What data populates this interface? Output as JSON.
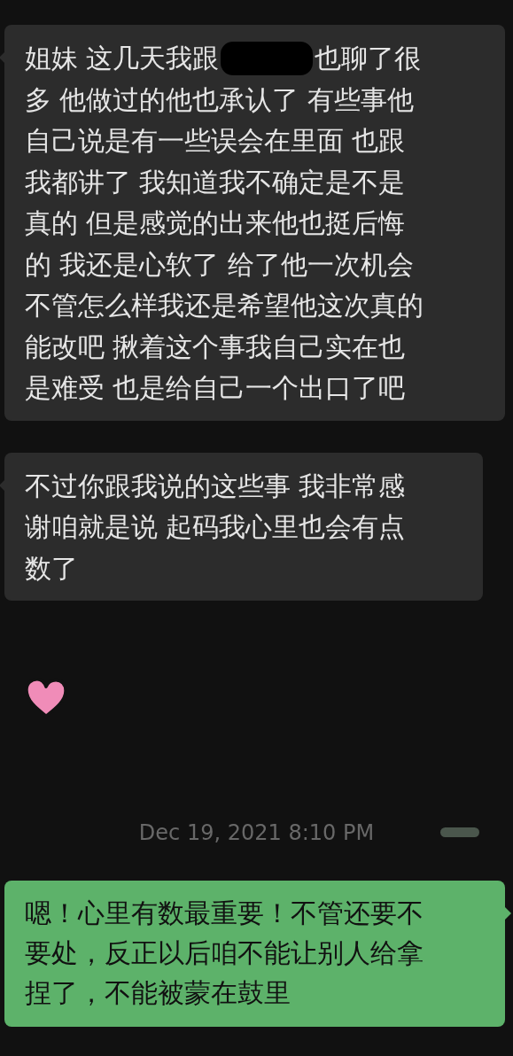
{
  "messages": [
    {
      "kind": "received",
      "lines": [
        [
          {
            "kind": "text",
            "text": "姐妹 这几天我跟"
          },
          {
            "kind": "redacted"
          },
          {
            "kind": "text",
            "text": "也聊了很"
          }
        ],
        [
          {
            "kind": "text",
            "text": "多 他做过的他也承认了 有些事他"
          }
        ],
        [
          {
            "kind": "text",
            "text": "自己说是有一些误会在里面 也跟"
          }
        ],
        [
          {
            "kind": "text",
            "text": "我都讲了 我知道我不确定是不是"
          }
        ],
        [
          {
            "kind": "text",
            "text": "真的 但是感觉的出来他也挺后悔"
          }
        ],
        [
          {
            "kind": "text",
            "text": "的 我还是心软了 给了他一次机会"
          }
        ],
        [
          {
            "kind": "text",
            "text": "不管怎么样我还是希望他这次真的"
          }
        ],
        [
          {
            "kind": "text",
            "text": "能改吧 揪着这个事我自己实在也"
          }
        ],
        [
          {
            "kind": "text",
            "text": "是难受 也是给自己一个出口了吧"
          }
        ]
      ]
    },
    {
      "kind": "received",
      "lines": [
        [
          {
            "kind": "text",
            "text": "不过你跟我说的这些事 我非常感"
          }
        ],
        [
          {
            "kind": "text",
            "text": "谢咱就是说 起码我心里也会有点"
          }
        ],
        [
          {
            "kind": "text",
            "text": "数了"
          }
        ]
      ]
    },
    {
      "kind": "sticker"
    },
    {
      "kind": "timestamp",
      "text": "Dec 19, 2021 8:10 PM",
      "redacted": true
    },
    {
      "kind": "sent",
      "lines": [
        [
          {
            "kind": "text",
            "text": "嗯！心里有数最重要！不管还要不"
          }
        ],
        [
          {
            "kind": "text",
            "text": "要处，反正以后咱不能让别人给拿"
          }
        ],
        [
          {
            "kind": "text",
            "text": "捏了，不能被蒙在鼓里"
          }
        ]
      ]
    }
  ]
}
